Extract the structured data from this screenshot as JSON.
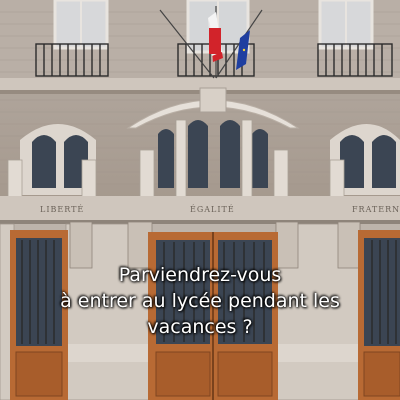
{
  "inscriptions": {
    "left": "LIBERTÉ",
    "center": "ÉGALITÉ",
    "right": "FRATERN"
  },
  "caption": {
    "line1": "Parviendrez-vous",
    "line2": "à entrer au lycée pendant les",
    "line3": "vacances ?"
  },
  "colors": {
    "stone": "#b5aba3",
    "door_wood": "#b86a34",
    "glass": "#3b4553",
    "flag_blue": "#1f3fa0",
    "flag_white": "#f4f4f4",
    "flag_red": "#d2232a"
  }
}
